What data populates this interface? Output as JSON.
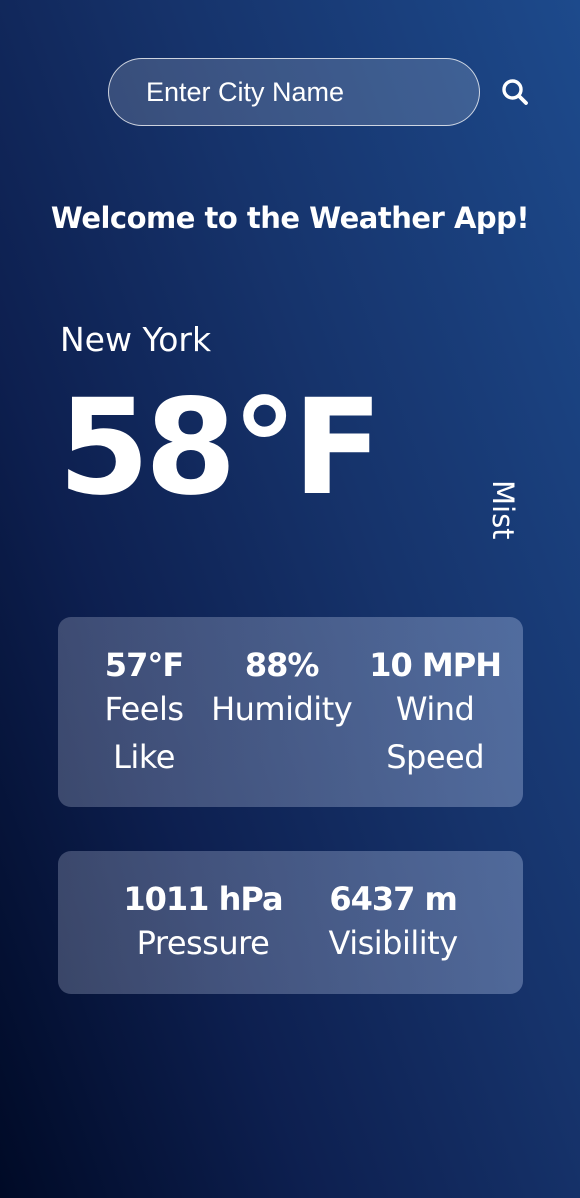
{
  "search": {
    "placeholder": "Enter City Name",
    "icon": "search-icon"
  },
  "welcome": "Welcome to the Weather App!",
  "weather": {
    "city": "New York",
    "temperature": "58°F",
    "condition": "Mist"
  },
  "details": [
    {
      "value": "57°F",
      "label": "Feels Like"
    },
    {
      "value": "88%",
      "label": "Humidity"
    },
    {
      "value": "10 MPH",
      "label": "Wind Speed"
    }
  ],
  "extra": [
    {
      "value": "1011 hPa",
      "label": "Pressure"
    },
    {
      "value": "6437 m",
      "label": "Visibility"
    }
  ],
  "colors": {
    "background_start": "#000a26",
    "background_end": "#1d4a8c",
    "text": "#ffffff"
  }
}
